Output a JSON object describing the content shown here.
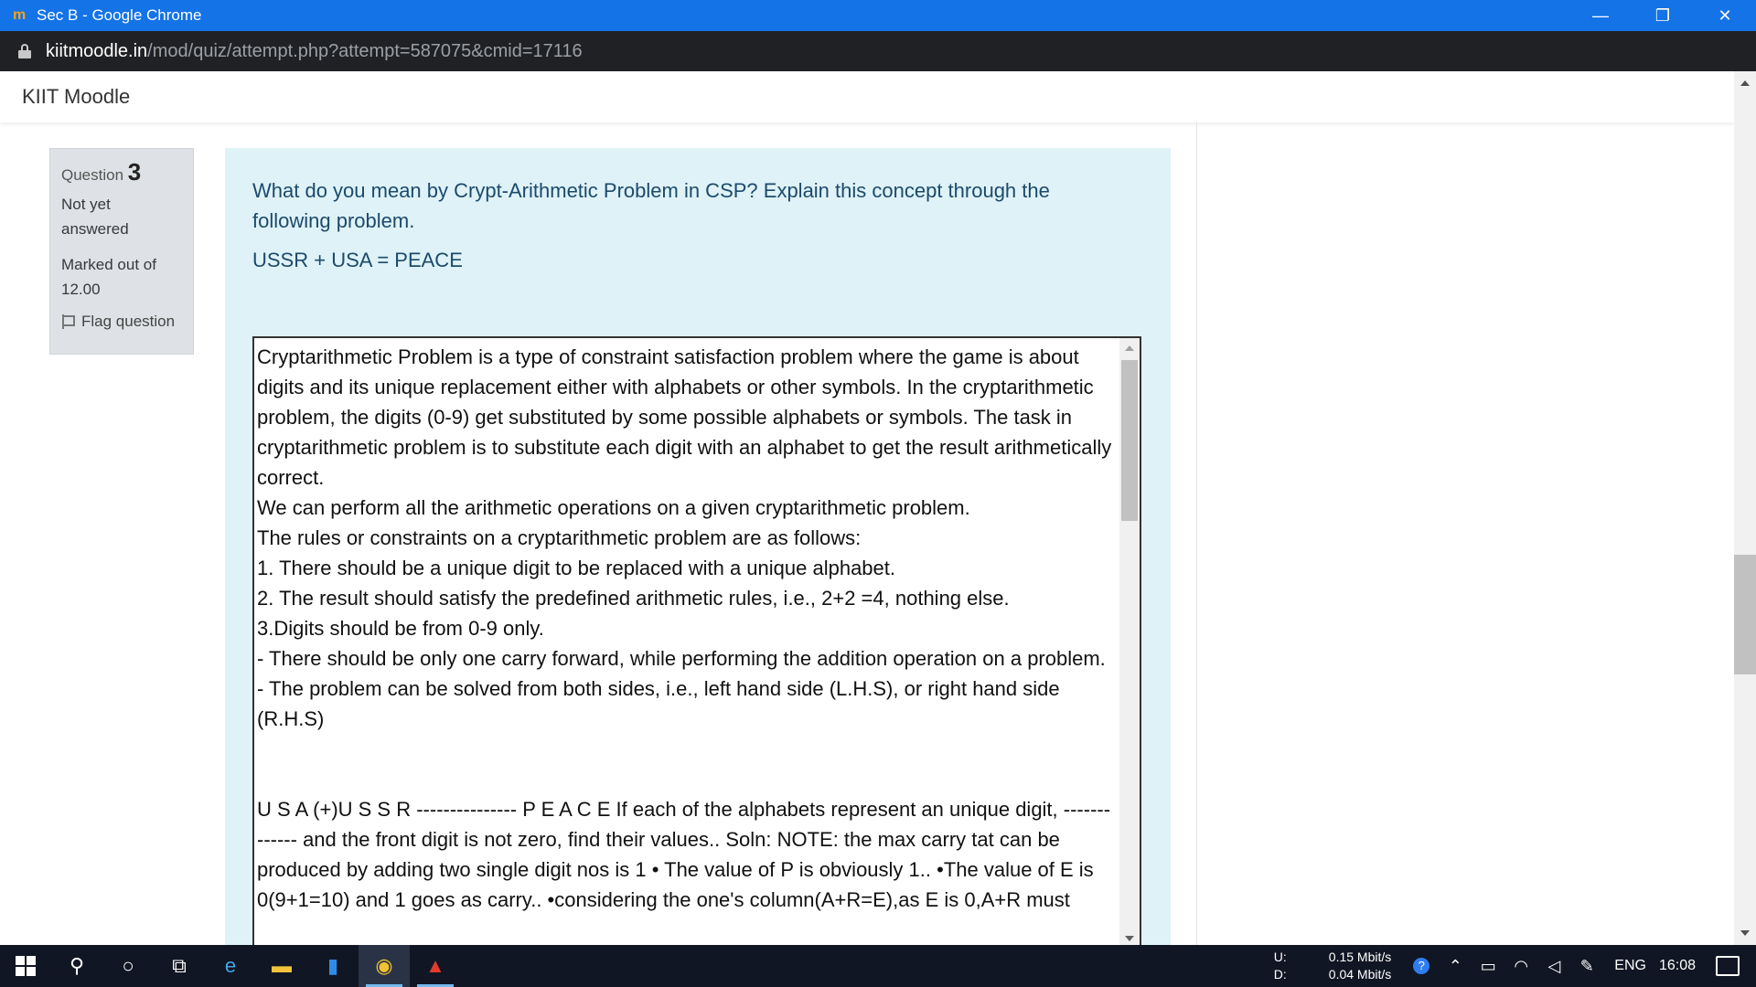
{
  "window": {
    "title": "Sec B - Google Chrome",
    "controls": {
      "minimize": "—",
      "restore": "❐",
      "close": "✕"
    }
  },
  "address_bar": {
    "host": "kiitmoodle.in",
    "path": "/mod/quiz/attempt.php?attempt=587075&cmid=17116"
  },
  "site": {
    "brand": "KIIT Moodle"
  },
  "question_info": {
    "label": "Question",
    "number": "3",
    "state_line1": "Not yet",
    "state_line2": "answered",
    "grade_line1": "Marked out of",
    "grade_line2": "12.00",
    "flag_label": "Flag question"
  },
  "question": {
    "text_line": "What do you mean by  Crypt-Arithmetic Problem in CSP? Explain  this concept  through the following problem.",
    "equation": "USSR + USA = PEACE"
  },
  "answer": {
    "text": "Cryptarithmetic Problem is a type of constraint satisfaction problem where the game is about digits and its unique replacement either with alphabets or other symbols. In the cryptarithmetic problem, the digits (0-9) get substituted by some possible alphabets or symbols. The task in cryptarithmetic problem is to substitute each digit with an alphabet to get the result arithmetically correct.\nWe can perform all the arithmetic operations on a given cryptarithmetic problem.\nThe rules or constraints on a cryptarithmetic problem are as follows:\n1. There should be a unique digit to be replaced with a unique alphabet.\n2. The result should satisfy the predefined arithmetic rules, i.e., 2+2 =4, nothing else.\n3.Digits should be from 0-9 only.\n- There should be only one carry forward, while performing the addition operation on a problem.\n- The problem can be solved from both sides, i.e., left hand side (L.H.S), or right hand side (R.H.S)\n\n\nU S A (+)U S S R --------------- P E A C E If each of the alphabets represent an unique digit, ------------- and the front digit is not zero, find their values.. Soln: NOTE: the max carry tat can be produced by adding two single digit nos is 1 • The value of P is obviously 1.. •The value of E is 0(9+1=10) and 1 goes as carry.. •considering the one's column(A+R=E),as E is 0,A+R must"
  },
  "taskbar": {
    "net_up_label": "U:",
    "net_down_label": "D:",
    "net_up": "0.15 Mbit/s",
    "net_down": "0.04 Mbit/s",
    "language": "ENG",
    "time": "16:08"
  },
  "colors": {
    "titlebar": "#1473e6",
    "addressbar": "#202124",
    "question_bg": "#def2f8",
    "info_bg": "#dee2e6",
    "taskbar": "#101623"
  }
}
